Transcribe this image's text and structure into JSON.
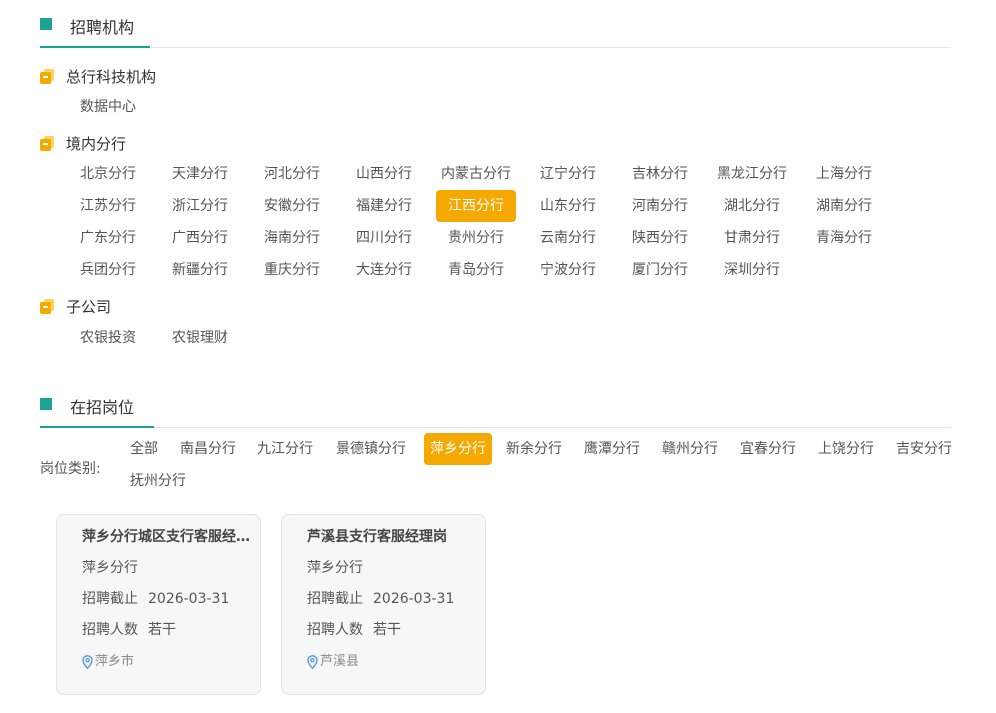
{
  "org_section": {
    "title": "招聘机构"
  },
  "groups": [
    {
      "title": "总行科技机构",
      "items": [
        "数据中心"
      ]
    },
    {
      "title": "境内分行",
      "items": [
        "北京分行",
        "天津分行",
        "河北分行",
        "山西分行",
        "内蒙古分行",
        "辽宁分行",
        "吉林分行",
        "黑龙江分行",
        "上海分行",
        "江苏分行",
        "浙江分行",
        "安徽分行",
        "福建分行",
        "江西分行",
        "山东分行",
        "河南分行",
        "湖北分行",
        "湖南分行",
        "广东分行",
        "广西分行",
        "海南分行",
        "四川分行",
        "贵州分行",
        "云南分行",
        "陕西分行",
        "甘肃分行",
        "青海分行",
        "兵团分行",
        "新疆分行",
        "重庆分行",
        "大连分行",
        "青岛分行",
        "宁波分行",
        "厦门分行",
        "深圳分行"
      ],
      "active_index": 13
    },
    {
      "title": "子公司",
      "items": [
        "农银投资",
        "农银理财"
      ]
    }
  ],
  "jobs_section": {
    "title": "在招岗位"
  },
  "category": {
    "label": "岗位类别:",
    "items": [
      "全部",
      "南昌分行",
      "九江分行",
      "景德镇分行",
      "萍乡分行",
      "新余分行",
      "鹰潭分行",
      "赣州分行",
      "宜春分行",
      "上饶分行",
      "吉安分行",
      "抚州分行"
    ],
    "active_index": 4
  },
  "jobs": [
    {
      "title": "萍乡分行城区支行客服经理岗",
      "org": "萍乡分行",
      "deadline_label": "招聘截止",
      "deadline": "2026-03-31",
      "count_label": "招聘人数",
      "count": "若干",
      "location": "萍乡市"
    },
    {
      "title": "芦溪县支行客服经理岗",
      "org": "萍乡分行",
      "deadline_label": "招聘截止",
      "deadline": "2026-03-31",
      "count_label": "招聘人数",
      "count": "若干",
      "location": "芦溪县"
    }
  ],
  "colors": {
    "accent": "#1aa394",
    "active": "#f5a800"
  }
}
